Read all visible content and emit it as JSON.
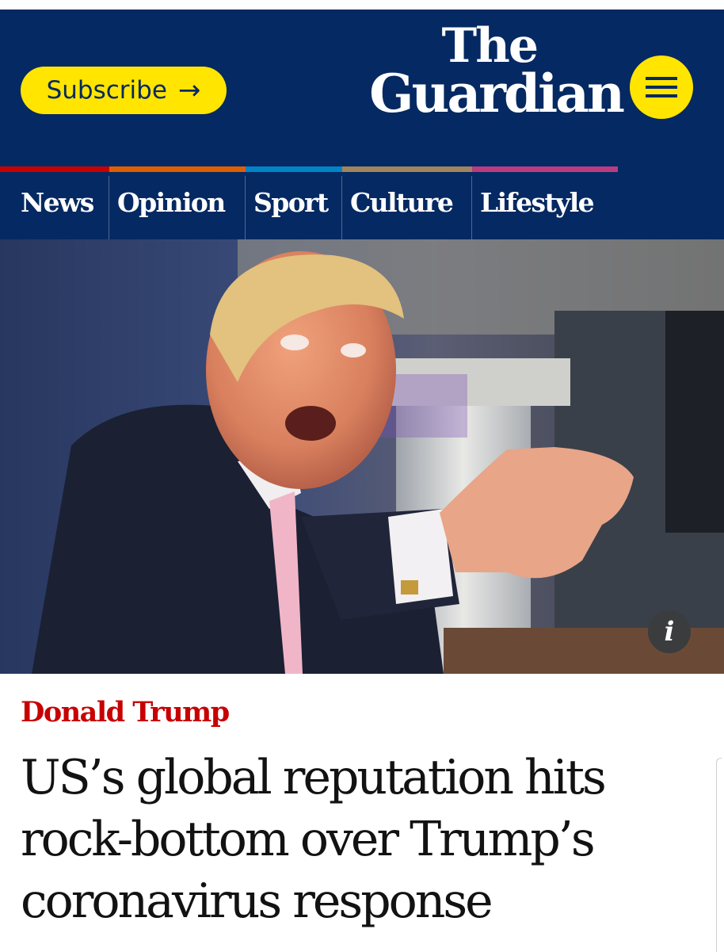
{
  "header": {
    "subscribe_label": "Subscribe",
    "subscribe_arrow": "→",
    "logo_line1": "The",
    "logo_line2": "Guardian",
    "menu_icon": "hamburger-menu-icon",
    "background_color": "#052962",
    "accent_color": "#ffe500"
  },
  "nav": {
    "items": [
      {
        "label": "News",
        "color": "#c70000"
      },
      {
        "label": "Opinion",
        "color": "#e05e00"
      },
      {
        "label": "Sport",
        "color": "#0084c6"
      },
      {
        "label": "Culture",
        "color": "#a1845c"
      },
      {
        "label": "Lifestyle",
        "color": "#bb3b80"
      }
    ]
  },
  "hero": {
    "info_label": "i"
  },
  "article": {
    "kicker": "Donald Trump",
    "headline": "US’s global reputation hits rock-bottom over Trump’s coronavirus response",
    "kicker_color": "#c70000"
  }
}
